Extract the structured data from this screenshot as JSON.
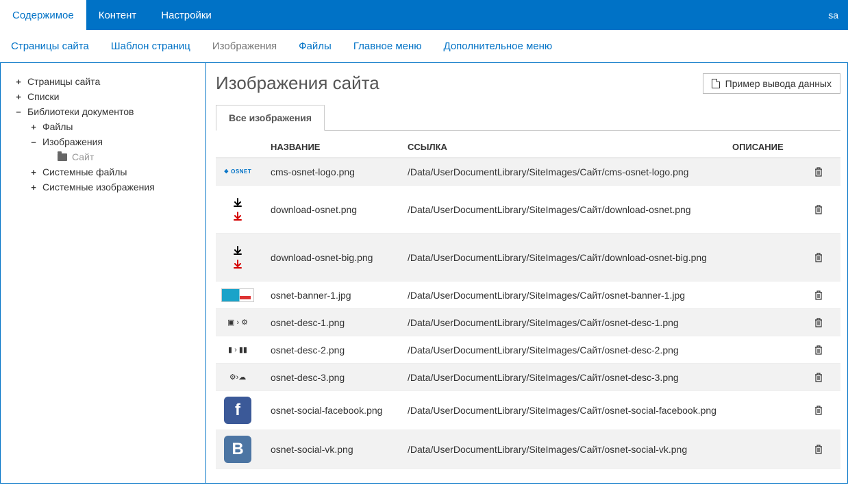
{
  "topbar": {
    "tabs": [
      "Содержимое",
      "Контент",
      "Настройки"
    ],
    "activeIndex": 0,
    "user": "sa"
  },
  "subnav": {
    "items": [
      "Страницы сайта",
      "Шаблон страниц",
      "Изображения",
      "Файлы",
      "Главное меню",
      "Дополнительное меню"
    ],
    "currentIndex": 2
  },
  "sidebar": {
    "nodes": [
      {
        "label": "Страницы сайта",
        "level": 1,
        "exp": "+"
      },
      {
        "label": "Списки",
        "level": 1,
        "exp": "+"
      },
      {
        "label": "Библиотеки документов",
        "level": 1,
        "exp": "−"
      },
      {
        "label": "Файлы",
        "level": 2,
        "exp": "+"
      },
      {
        "label": "Изображения",
        "level": 2,
        "exp": "−"
      },
      {
        "label": "Сайт",
        "level": 3,
        "exp": "",
        "icon": "folder",
        "selected": true
      },
      {
        "label": "Системные файлы",
        "level": 2,
        "exp": "+"
      },
      {
        "label": "Системные изображения",
        "level": 2,
        "exp": "+"
      }
    ]
  },
  "page": {
    "title": "Изображения сайта",
    "exampleButton": "Пример вывода данных",
    "tab": "Все изображения"
  },
  "table": {
    "headers": {
      "name": "НАЗВАНИЕ",
      "link": "ССЫЛКА",
      "desc": "ОПИСАНИЕ"
    },
    "rows": [
      {
        "name": "cms-osnet-logo.png",
        "link": "/Data/UserDocumentLibrary/SiteImages/Сайт/cms-osnet-logo.png",
        "thumb": "osnet",
        "alt": true
      },
      {
        "name": "download-osnet.png",
        "link": "/Data/UserDocumentLibrary/SiteImages/Сайт/download-osnet.png",
        "thumb": "download",
        "big": true
      },
      {
        "name": "download-osnet-big.png",
        "link": "/Data/UserDocumentLibrary/SiteImages/Сайт/download-osnet-big.png",
        "thumb": "download",
        "alt": true,
        "big": true
      },
      {
        "name": "osnet-banner-1.jpg",
        "link": "/Data/UserDocumentLibrary/SiteImages/Сайт/osnet-banner-1.jpg",
        "thumb": "banner"
      },
      {
        "name": "osnet-desc-1.png",
        "link": "/Data/UserDocumentLibrary/SiteImages/Сайт/osnet-desc-1.png",
        "thumb": "desc1",
        "alt": true
      },
      {
        "name": "osnet-desc-2.png",
        "link": "/Data/UserDocumentLibrary/SiteImages/Сайт/osnet-desc-2.png",
        "thumb": "desc2"
      },
      {
        "name": "osnet-desc-3.png",
        "link": "/Data/UserDocumentLibrary/SiteImages/Сайт/osnet-desc-3.png",
        "thumb": "desc3",
        "alt": true
      },
      {
        "name": "osnet-social-facebook.png",
        "link": "/Data/UserDocumentLibrary/SiteImages/Сайт/osnet-social-facebook.png",
        "thumb": "fb",
        "icon56": true
      },
      {
        "name": "osnet-social-vk.png",
        "link": "/Data/UserDocumentLibrary/SiteImages/Сайт/osnet-social-vk.png",
        "thumb": "vk",
        "alt": true,
        "icon56": true
      }
    ]
  }
}
